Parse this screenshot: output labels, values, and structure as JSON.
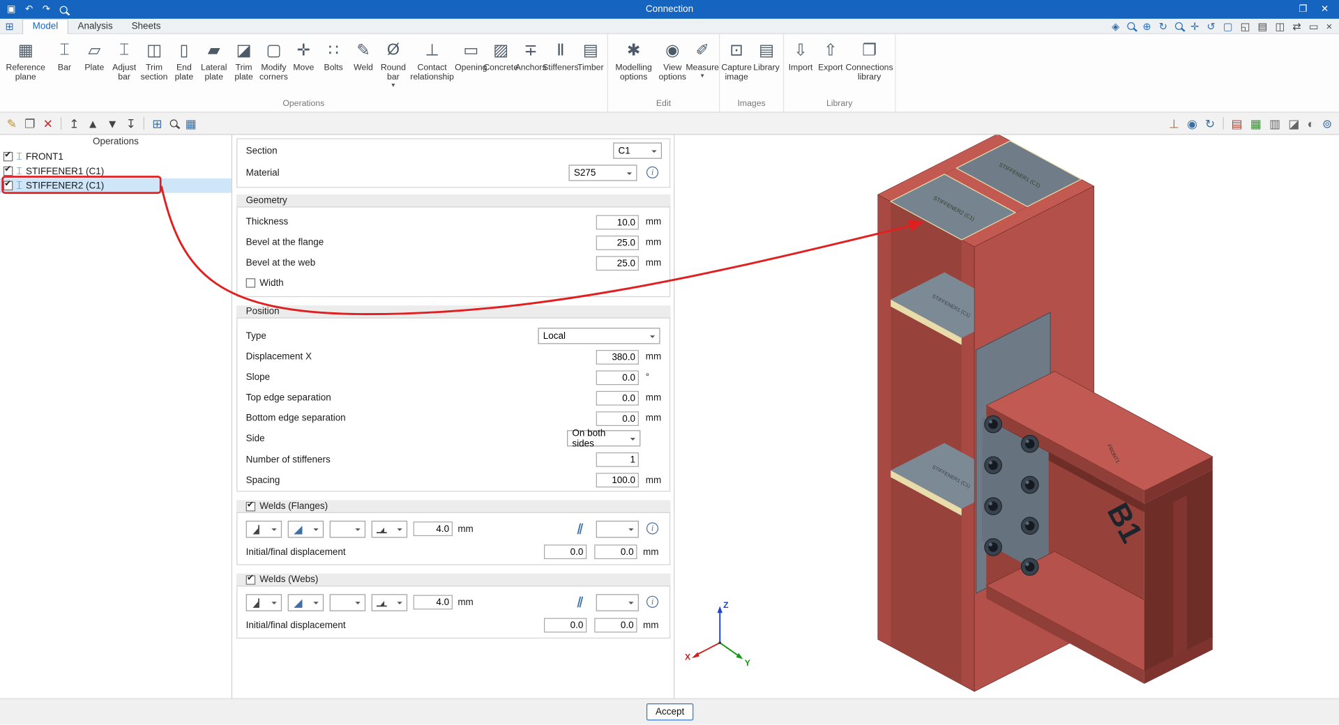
{
  "titlebar": {
    "title": "Connection",
    "left_icons": [
      {
        "name": "save-icon",
        "glyph": "▣"
      },
      {
        "name": "undo-icon",
        "glyph": "↶"
      },
      {
        "name": "redo-icon",
        "glyph": "↷"
      },
      {
        "name": "search-icon",
        "special": "mag"
      }
    ],
    "right_icons": [
      {
        "name": "restore-window-icon",
        "glyph": "❐"
      },
      {
        "name": "close-window-icon",
        "glyph": "✕"
      }
    ]
  },
  "menubar": {
    "app_icon": "⊞",
    "tabs": [
      {
        "label": "Model",
        "active": true
      },
      {
        "label": "Analysis",
        "active": false
      },
      {
        "label": "Sheets",
        "active": false
      }
    ],
    "right_icons": [
      {
        "name": "select-view-icon",
        "glyph": "◈",
        "color": "#2e6db5"
      },
      {
        "name": "zoom-extents-icon",
        "special": "mag",
        "color": "#2e6db5"
      },
      {
        "name": "zoom-in-icon",
        "glyph": "⊕",
        "color": "#2e6db5"
      },
      {
        "name": "refresh-view-icon",
        "glyph": "↻",
        "color": "#2e6db5"
      },
      {
        "name": "zoom-window-icon",
        "special": "mag",
        "color": "#2e6db5"
      },
      {
        "name": "pan-icon",
        "glyph": "✛",
        "color": "#2e6db5"
      },
      {
        "name": "orbit-icon",
        "glyph": "↺",
        "color": "#2e6db5"
      },
      {
        "name": "fullscreen-icon",
        "glyph": "▢",
        "color": "#2e6db5"
      },
      {
        "name": "window-layout-icon",
        "glyph": "◱",
        "color": "#444"
      },
      {
        "name": "display-icon",
        "glyph": "▤",
        "color": "#444"
      },
      {
        "name": "chart-icon",
        "glyph": "◫",
        "color": "#444"
      },
      {
        "name": "sync-icon",
        "glyph": "⇄",
        "color": "#444"
      },
      {
        "name": "notes-icon",
        "glyph": "▭",
        "color": "#444"
      },
      {
        "name": "close-panel-icon",
        "glyph": "×",
        "color": "#444"
      }
    ]
  },
  "ribbon": {
    "arrow_glyph": "▾",
    "groups": [
      {
        "label": "Operations",
        "items": [
          {
            "label": "Reference plane",
            "icon": "▦",
            "name": "reference-plane"
          },
          {
            "label": "Bar",
            "icon": "⌶",
            "name": "bar"
          },
          {
            "label": "Plate",
            "icon": "▱",
            "name": "plate"
          },
          {
            "label": "Adjust bar",
            "icon": "⌶",
            "name": "adjust-bar"
          },
          {
            "label": "Trim section",
            "icon": "◫",
            "name": "trim-section"
          },
          {
            "label": "End plate",
            "icon": "▯",
            "name": "end-plate"
          },
          {
            "label": "Lateral plate",
            "icon": "▰",
            "name": "lateral-plate"
          },
          {
            "label": "Trim plate",
            "icon": "◪",
            "name": "trim-plate"
          },
          {
            "label": "Modify corners",
            "icon": "▢",
            "name": "modify-corners"
          },
          {
            "label": "Move",
            "icon": "✛",
            "name": "move"
          },
          {
            "label": "Bolts",
            "icon": "∷",
            "name": "bolts"
          },
          {
            "label": "Weld",
            "icon": "✎",
            "name": "weld"
          },
          {
            "label": "Round bar",
            "icon": "Ø",
            "name": "round-bar",
            "arrow": true
          },
          {
            "label": "Contact relationship",
            "icon": "⊥",
            "name": "contact-relationship"
          },
          {
            "label": "Opening",
            "icon": "▭",
            "name": "opening"
          },
          {
            "label": "Concrete",
            "icon": "▨",
            "name": "concrete"
          },
          {
            "label": "Anchors",
            "icon": "∓",
            "name": "anchors"
          },
          {
            "label": "Stiffeners",
            "icon": "Ⅱ",
            "name": "stiffeners"
          },
          {
            "label": "Timber",
            "icon": "▤",
            "name": "timber"
          }
        ]
      },
      {
        "label": "Edit",
        "items": [
          {
            "label": "Modelling options",
            "icon": "✱",
            "name": "modelling-options"
          },
          {
            "label": "View options",
            "icon": "◉",
            "name": "view-options"
          },
          {
            "label": "Measure",
            "icon": "✐",
            "name": "measure",
            "arrow": true
          }
        ]
      },
      {
        "label": "Images",
        "items": [
          {
            "label": "Capture image",
            "icon": "⊡",
            "name": "capture-image"
          },
          {
            "label": "Library",
            "icon": "▤",
            "name": "library"
          }
        ]
      },
      {
        "label": "Library",
        "items": [
          {
            "label": "Import",
            "icon": "⇩",
            "name": "import"
          },
          {
            "label": "Export",
            "icon": "⇧",
            "name": "export"
          },
          {
            "label": "Connections library",
            "icon": "❐",
            "name": "connections-library"
          }
        ]
      }
    ]
  },
  "ops_toolbar": [
    {
      "name": "edit-operation-icon",
      "glyph": "✎",
      "color": "#c09020"
    },
    {
      "name": "copy-operation-icon",
      "glyph": "❐",
      "color": "#555"
    },
    {
      "name": "delete-operation-icon",
      "glyph": "✕",
      "color": "#c03030"
    },
    {
      "sep": true
    },
    {
      "name": "move-top-icon",
      "glyph": "↥",
      "color": "#444"
    },
    {
      "name": "move-up-icon",
      "glyph": "▲",
      "color": "#444"
    },
    {
      "name": "move-down-icon",
      "glyph": "▼",
      "color": "#444"
    },
    {
      "name": "move-bottom-icon",
      "glyph": "↧",
      "color": "#444"
    },
    {
      "sep": true
    },
    {
      "name": "group-tree-icon",
      "glyph": "⊞",
      "color": "#3a6ea5"
    },
    {
      "name": "search-tree-icon",
      "special": "mag",
      "color": "#444"
    },
    {
      "name": "delete-all-icon",
      "glyph": "▦",
      "color": "#3a6ea5"
    }
  ],
  "view_toolbar": [
    {
      "name": "ucs-icon",
      "glyph": "⊥",
      "color": "#b06030"
    },
    {
      "name": "visibility-icon",
      "glyph": "◉",
      "color": "#3a6ea5"
    },
    {
      "name": "orbit-view-icon",
      "glyph": "↻",
      "color": "#3a6ea5"
    },
    {
      "sep": true
    },
    {
      "name": "solid-view-icon",
      "glyph": "▤",
      "color": "#b04030"
    },
    {
      "name": "mesh-view-icon",
      "glyph": "▦",
      "color": "#3d8b3d"
    },
    {
      "name": "sheet-view-icon",
      "glyph": "▥",
      "color": "#666"
    },
    {
      "name": "layers-icon",
      "glyph": "◪",
      "color": "#666"
    },
    {
      "name": "shading-icon",
      "glyph": "◐",
      "color": "#666"
    },
    {
      "name": "connections-icon",
      "glyph": "⊚",
      "color": "#3a6ea5"
    }
  ],
  "operations": {
    "title": "Operations",
    "item_icon": "⌶",
    "items": [
      {
        "label": "FRONT1",
        "checked": true,
        "selected": false
      },
      {
        "label": "STIFFENER1 (C1)",
        "checked": true,
        "selected": false
      },
      {
        "label": "STIFFENER2 (C1)",
        "checked": true,
        "selected": true
      }
    ]
  },
  "properties": {
    "section": {
      "label": "Section",
      "value": "C1"
    },
    "material": {
      "label": "Material",
      "value": "S275"
    },
    "geometry": {
      "title": "Geometry",
      "rows": [
        {
          "label": "Thickness",
          "value": "10.0",
          "unit": "mm"
        },
        {
          "label": "Bevel at the flange",
          "value": "25.0",
          "unit": "mm"
        },
        {
          "label": "Bevel at the web",
          "value": "25.0",
          "unit": "mm"
        }
      ],
      "width_checkbox": {
        "label": "Width",
        "checked": false
      }
    },
    "position": {
      "title": "Position",
      "type": {
        "label": "Type",
        "value": "Local"
      },
      "rows": [
        {
          "label": "Displacement X",
          "value": "380.0",
          "unit": "mm"
        },
        {
          "label": "Slope",
          "value": "0.0",
          "unit": "°"
        },
        {
          "label": "Top edge separation",
          "value": "0.0",
          "unit": "mm"
        },
        {
          "label": "Bottom edge separation",
          "value": "0.0",
          "unit": "mm"
        }
      ],
      "side": {
        "label": "Side",
        "value": "On both sides"
      },
      "count": {
        "label": "Number of stiffeners",
        "value": "1"
      },
      "spacing": {
        "label": "Spacing",
        "value": "100.0",
        "unit": "mm"
      }
    },
    "welds_flanges": {
      "title": "Welds (Flanges)",
      "checked": true,
      "size": "4.0",
      "unit": "mm",
      "row2_label": "Initial/final displacement",
      "initial": "0.0",
      "final": "0.0"
    },
    "welds_webs": {
      "title": "Welds (Webs)",
      "checked": true,
      "size": "4.0",
      "unit": "mm",
      "row2_label": "Initial/final displacement",
      "initial": "0.0",
      "final": "0.0"
    }
  },
  "icons": {
    "parallel": "∥"
  },
  "viewport": {
    "labels": {
      "beam": "B1",
      "top_plate_left": "STIFFENER2 (C1)",
      "top_plate_right": "STIFFENER1 (C1)",
      "mid_plate_1": "STIFFENER1 (C1)",
      "mid_plate_2": "STIFFENER1 (C1)",
      "front": "FRONT1"
    },
    "axes": {
      "x": "X",
      "y": "Y",
      "z": "Z"
    }
  },
  "footer": {
    "accept": "Accept"
  },
  "colors": {
    "titlebar": "#1565c0",
    "annotation": "#e02020",
    "selection": "#cfe5f8",
    "steel_red": "#b3504a",
    "plate_gray": "#76848f",
    "weld_cream": "#e9dcab"
  }
}
